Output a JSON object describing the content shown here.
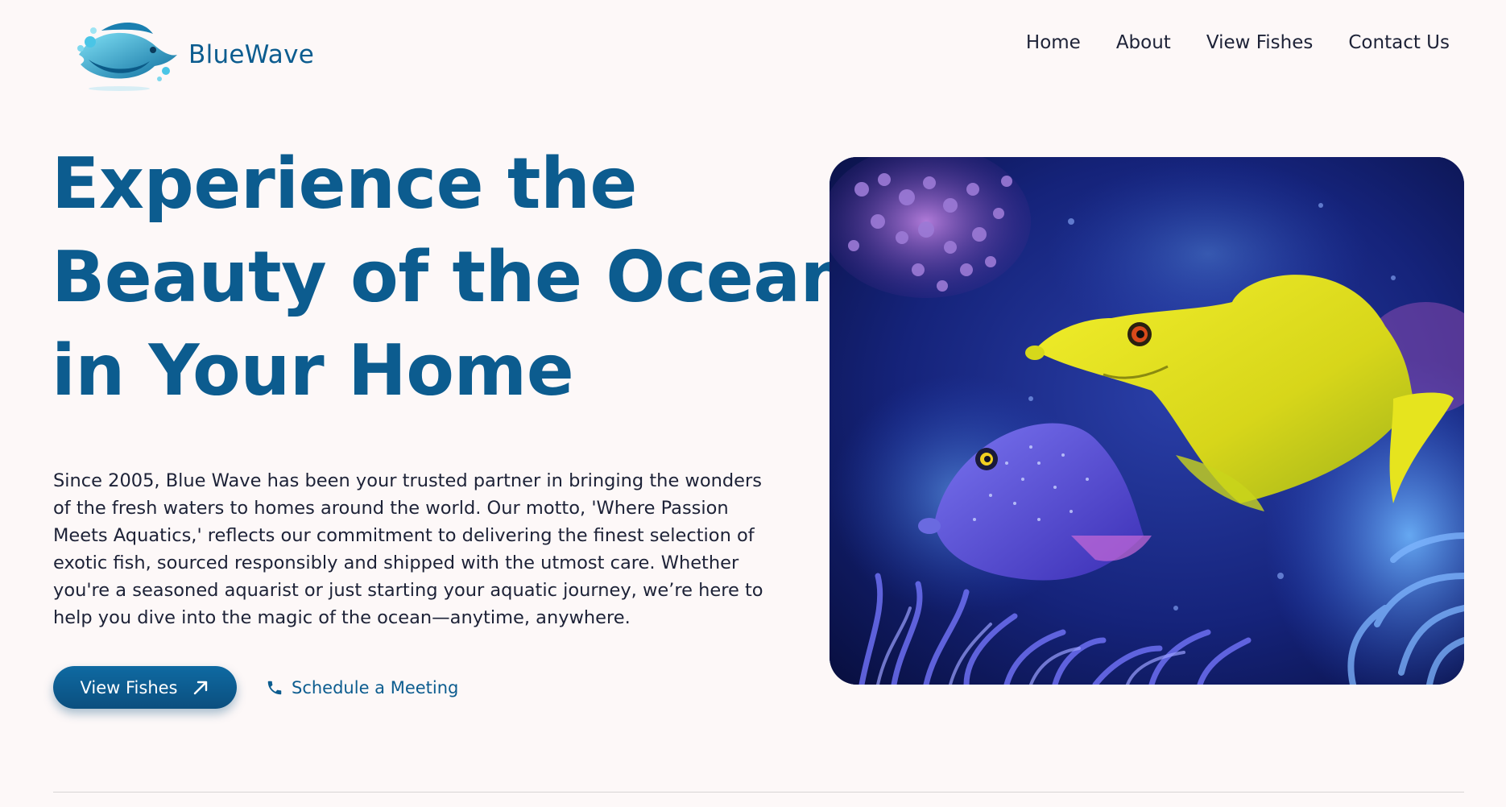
{
  "brand": {
    "name": "BlueWave"
  },
  "nav": {
    "items": [
      "Home",
      "About",
      "View Fishes",
      "Contact Us"
    ]
  },
  "hero": {
    "title_lines": [
      "Experience the",
      "Beauty of the Ocean",
      "in Your Home"
    ],
    "description_lines": [
      "Since 2005, Blue Wave has been your trusted partner in bringing the wonders",
      "of the fresh waters to homes around the world. Our motto, 'Where Passion",
      "Meets Aquatics,' reflects our commitment to delivering the finest selection of",
      "exotic fish, sourced responsibly and shipped with the utmost care. Whether",
      "you're a seasoned aquarist or just starting your aquatic journey, we’re here to",
      "help you dive into the magic of the ocean—anytime, anywhere."
    ],
    "primary_button": {
      "label": "View Fishes",
      "icon": "arrow-up-right-icon"
    },
    "secondary_link": {
      "label": "Schedule a Meeting",
      "icon": "phone-icon"
    }
  },
  "colors": {
    "background": "#fdf8f8",
    "brand": "#0c5c8f",
    "text": "#1d2237"
  }
}
